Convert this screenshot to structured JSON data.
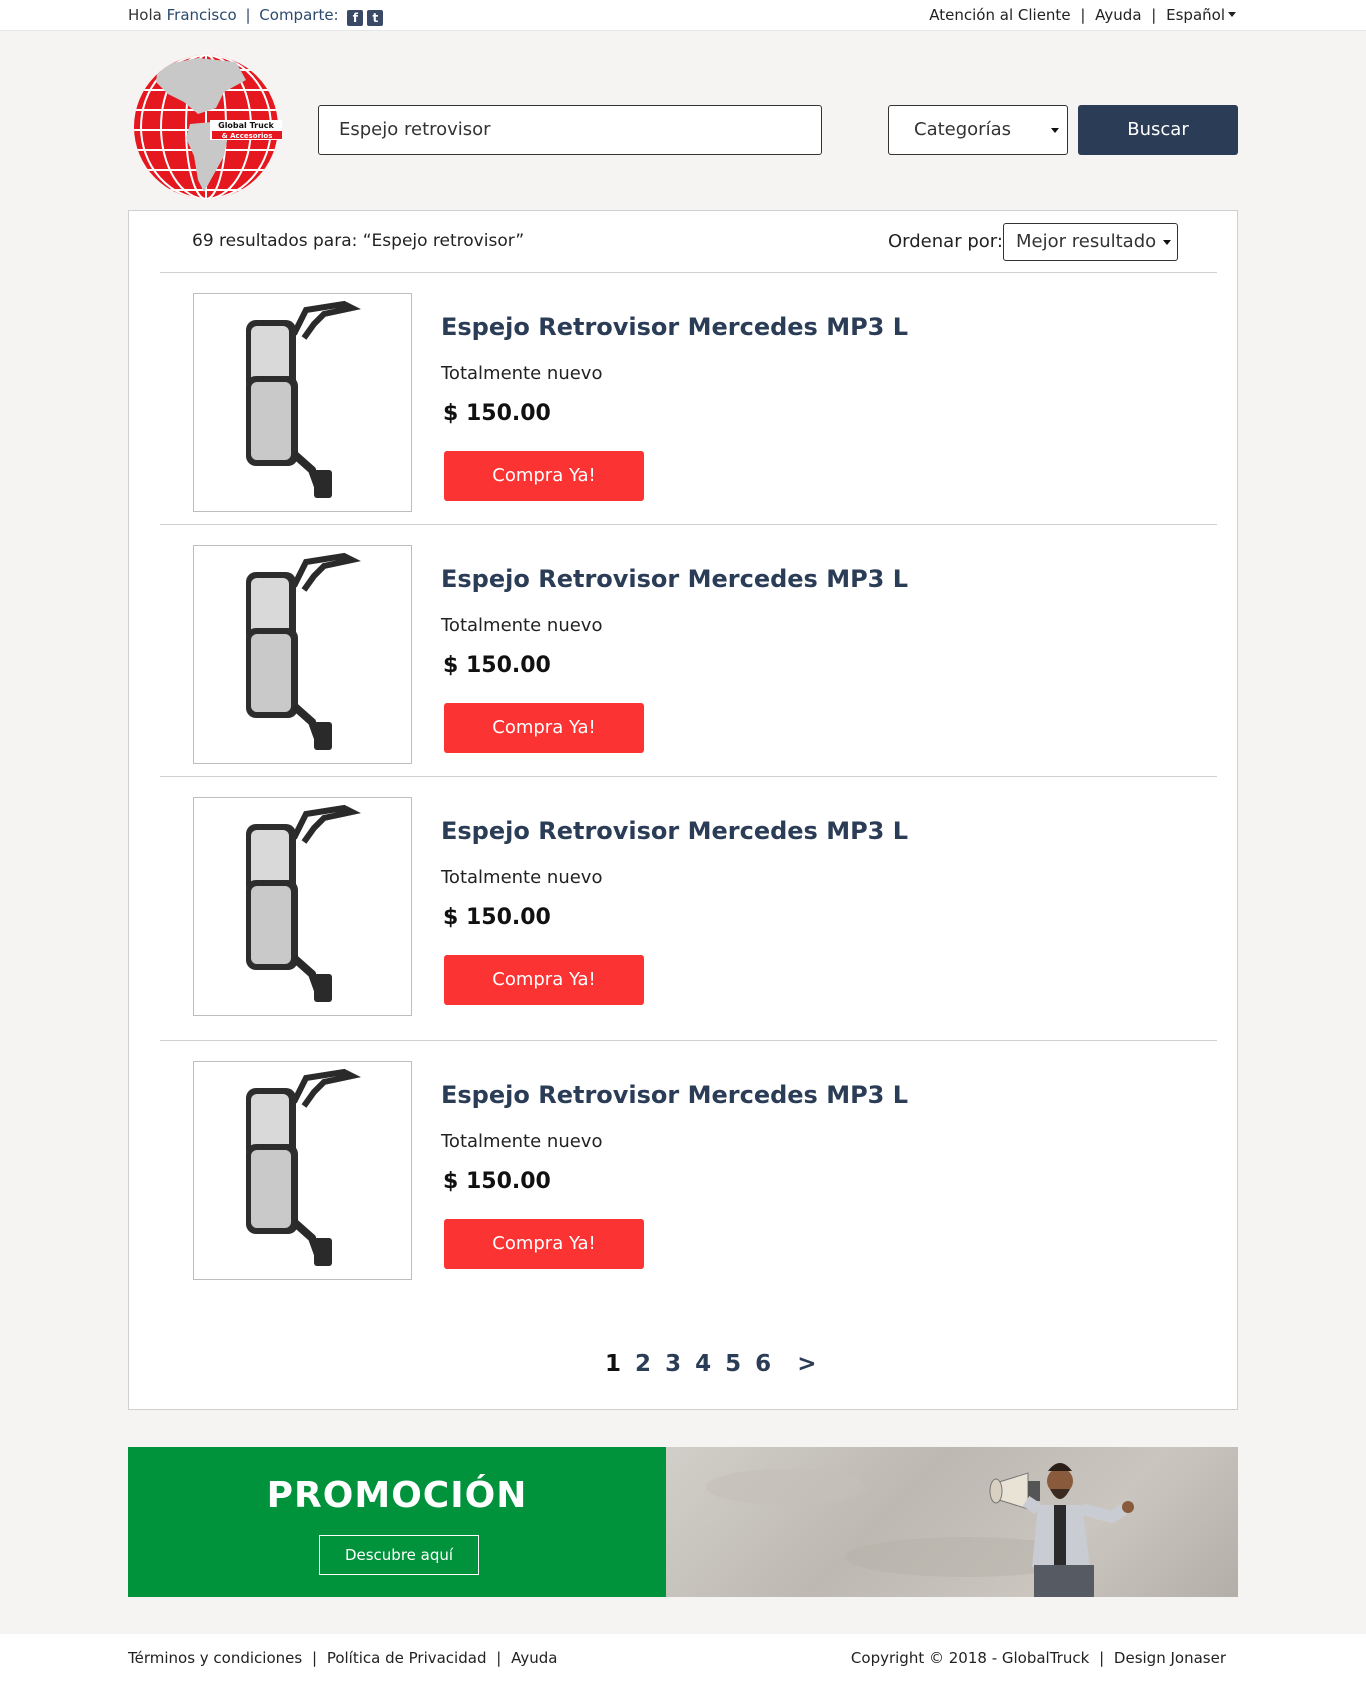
{
  "topbar": {
    "greeting": "Hola",
    "user_name": "Francisco",
    "separator": "|",
    "share_label": "Comparte:",
    "social": [
      {
        "icon": "facebook-icon",
        "glyph": "f"
      },
      {
        "icon": "twitter-icon",
        "glyph": "t"
      }
    ],
    "links": [
      "Atención al Cliente",
      "Ayuda",
      "Español"
    ]
  },
  "brand": {
    "logo_text_1": "Global Truck",
    "logo_text_2": "& Accesorios",
    "logo_color": "#e5171f"
  },
  "search": {
    "value": "Espejo retrovisor",
    "category_label": "Categorías",
    "button_label": "Buscar"
  },
  "results": {
    "count_text": "69 resultados para: “Espejo retrovisor”",
    "sort_label": "Ordenar por:",
    "sort_value": "Mejor resultado"
  },
  "products": [
    {
      "title": "Espejo Retrovisor Mercedes MP3 L",
      "subtitle": "Totalmente nuevo",
      "price": "$ 150.00",
      "button": "Compra Ya!"
    },
    {
      "title": "Espejo Retrovisor Mercedes MP3 L",
      "subtitle": "Totalmente nuevo",
      "price": "$ 150.00",
      "button": "Compra Ya!"
    },
    {
      "title": "Espejo Retrovisor Mercedes MP3 L",
      "subtitle": "Totalmente nuevo",
      "price": "$ 150.00",
      "button": "Compra Ya!"
    },
    {
      "title": "Espejo Retrovisor Mercedes MP3 L",
      "subtitle": "Totalmente nuevo",
      "price": "$ 150.00",
      "button": "Compra Ya!"
    }
  ],
  "pagination": {
    "pages": [
      "1",
      "2",
      "3",
      "4",
      "5",
      "6"
    ],
    "current": "1",
    "next": ">"
  },
  "promo": {
    "title": "PROMOCIÓN",
    "button": "Descubre aquí",
    "background_color": "#00933b"
  },
  "footer": {
    "links": [
      "Términos y condiciones",
      "Política de Privacidad",
      "Ayuda"
    ],
    "copyright": "Copyright © 2018 - GlobalTruck",
    "credit": "Design Jonaser"
  },
  "colors": {
    "primary": "#2b3d56",
    "buy": "#fc3333",
    "promo": "#00933b"
  }
}
